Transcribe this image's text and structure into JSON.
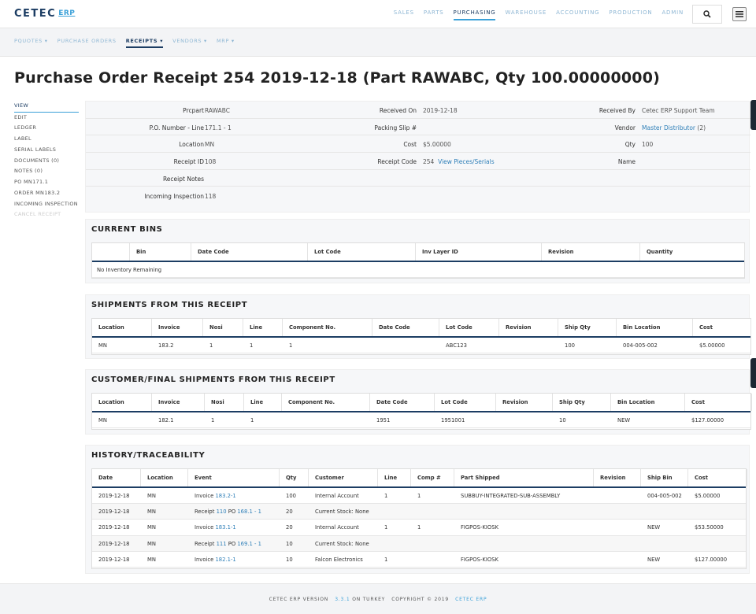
{
  "topbar": {
    "logo": "CETEC",
    "logo_suffix": "ERP",
    "nav": [
      "SALES",
      "PARTS",
      "PURCHASING",
      "WAREHOUSE",
      "ACCOUNTING",
      "PRODUCTION",
      "ADMIN"
    ],
    "active_nav": "PURCHASING",
    "search_icon": "search-icon",
    "menu_icon": "hamburger-icon"
  },
  "subnav": {
    "items": [
      "PQUOTES ▾",
      "PURCHASE ORDERS",
      "RECEIPTS ▾",
      "VENDORS ▾",
      "MRP ▾"
    ],
    "active": "RECEIPTS ▾"
  },
  "page_title": "Purchase Order Receipt 254 2019-12-18 (Part RAWABC, Qty 100.00000000)",
  "sidebar": {
    "items": [
      "VIEW",
      "EDIT",
      "LEDGER",
      "LABEL",
      "SERIAL LABELS",
      "DOCUMENTS (0)",
      "NOTES (0)",
      "PO MN171.1",
      "ORDER MN183.2",
      "INCOMING INSPECTION",
      "CANCEL RECEIPT"
    ]
  },
  "details": {
    "prcpart_label": "Prcpart",
    "prcpart_value": "RAWABC",
    "received_on_label": "Received On",
    "received_on_value": "2019-12-18",
    "received_by_label": "Received By",
    "received_by_value": "Cetec ERP Support Team",
    "po_label": "P.O. Number - Line",
    "po_value": "171.1 - 1",
    "packing_label": "Packing Slip #",
    "packing_value": "",
    "vendor_label": "Vendor",
    "vendor_value": "Master Distributor",
    "vendor_count": "(2)",
    "location_label": "Location",
    "location_value": "MN",
    "cost_label": "Cost",
    "cost_value": "$5.00000",
    "qty_label": "Qty",
    "qty_value": "100",
    "receipt_id_label": "Receipt ID",
    "receipt_id_value": "108",
    "receipt_code_label": "Receipt Code",
    "receipt_code_value": "254",
    "view_pieces": "View Pieces/Serials",
    "name_label": "Name",
    "name_value": "",
    "receipt_notes_label": "Receipt Notes",
    "receipt_notes_value": "",
    "incoming_label": "Incoming Inspection",
    "incoming_value": "118"
  },
  "current_bins": {
    "title": "CURRENT BINS",
    "columns": [
      "",
      "Bin",
      "Date Code",
      "Lot Code",
      "Inv Layer ID",
      "Revision",
      "Quantity"
    ],
    "empty_text": "No Inventory Remaining"
  },
  "shipments": {
    "title": "SHIPMENTS FROM THIS RECEIPT",
    "columns": [
      "Location",
      "Invoice",
      "Nosi",
      "Line",
      "Component No.",
      "Date Code",
      "Lot Code",
      "Revision",
      "Ship Qty",
      "Bin Location",
      "Cost"
    ],
    "rows": [
      [
        "MN",
        "183.2",
        "1",
        "1",
        "1",
        "",
        "ABC123",
        "",
        "100",
        "004-005-002",
        "$5.00000"
      ]
    ]
  },
  "customer_shipments": {
    "title": "CUSTOMER/FINAL SHIPMENTS FROM THIS RECEIPT",
    "columns": [
      "Location",
      "Invoice",
      "Nosi",
      "Line",
      "Component No.",
      "Date Code",
      "Lot Code",
      "Revision",
      "Ship Qty",
      "Bin Location",
      "Cost"
    ],
    "rows": [
      [
        "MN",
        "182.1",
        "1",
        "1",
        "",
        "1951",
        "1951001",
        "",
        "10",
        "NEW",
        "$127.00000"
      ]
    ]
  },
  "history": {
    "title": "HISTORY/TRACEABILITY",
    "columns": [
      "Date",
      "Location",
      "Event",
      "Qty",
      "Customer",
      "Line",
      "Comp #",
      "Part Shipped",
      "Revision",
      "Ship Bin",
      "Cost"
    ],
    "rows": [
      {
        "date": "2019-12-18",
        "location": "MN",
        "event_prefix": "Invoice",
        "event_link": "183.2-1",
        "event_mid": "",
        "event_link2": "",
        "qty": "100",
        "customer": "Internal Account",
        "customer_link": true,
        "line": "1",
        "comp": "1",
        "part": "SUBBUY-INTEGRATED-SUB-ASSEMBLY",
        "revision": "",
        "bin": "004-005-002",
        "cost": "$5.00000"
      },
      {
        "date": "2019-12-18",
        "location": "MN",
        "event_prefix": "Receipt",
        "event_link": "110",
        "event_mid": "PO",
        "event_link2": "168.1 - 1",
        "qty": "20",
        "customer": "Current Stock: None",
        "customer_link": false,
        "line": "",
        "comp": "",
        "part": "",
        "revision": "",
        "bin": "",
        "cost": ""
      },
      {
        "date": "2019-12-18",
        "location": "MN",
        "event_prefix": "Invoice",
        "event_link": "183.1-1",
        "event_mid": "",
        "event_link2": "",
        "qty": "20",
        "customer": "Internal Account",
        "customer_link": true,
        "line": "1",
        "comp": "1",
        "part": "FIGPOS-KIOSK",
        "revision": "",
        "bin": "NEW",
        "cost": "$53.50000"
      },
      {
        "date": "2019-12-18",
        "location": "MN",
        "event_prefix": "Receipt",
        "event_link": "111",
        "event_mid": "PO",
        "event_link2": "169.1 - 1",
        "qty": "10",
        "customer": "Current Stock: None",
        "customer_link": false,
        "line": "",
        "comp": "",
        "part": "",
        "revision": "",
        "bin": "",
        "cost": ""
      },
      {
        "date": "2019-12-18",
        "location": "MN",
        "event_prefix": "Invoice",
        "event_link": "182.1-1",
        "event_mid": "",
        "event_link2": "",
        "qty": "10",
        "customer": "Falcon Electronics",
        "customer_link": true,
        "line": "1",
        "comp": "",
        "part": "FIGPOS-KIOSK",
        "revision": "",
        "bin": "NEW",
        "cost": "$127.00000"
      }
    ]
  },
  "footer": {
    "version_label": "CETEC ERP VERSION",
    "version": "3.3.1",
    "on_text": "ON TURKEY",
    "copyright": "COPYRIGHT © 2019",
    "brand": "CETEC ERP"
  }
}
